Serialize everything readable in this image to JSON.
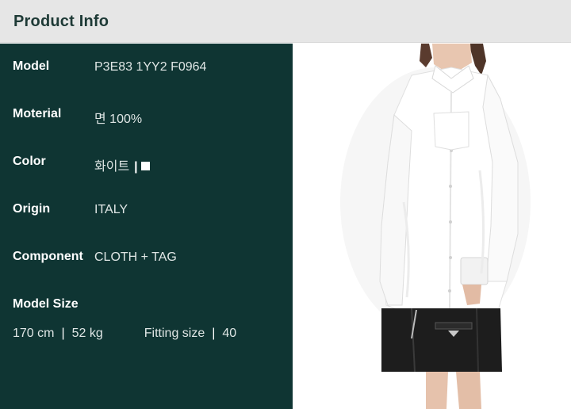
{
  "header": {
    "title": "Product Info"
  },
  "info": {
    "rows": [
      {
        "label": "Model",
        "value": "P3E83 1YY2 F0964"
      },
      {
        "label": "Moterial",
        "value": "면 100%"
      },
      {
        "label": "Color",
        "value": "화이트",
        "separator": "|"
      },
      {
        "label": "Origin",
        "value": "ITALY"
      },
      {
        "label": "Component",
        "value": "CLOTH + TAG"
      }
    ],
    "model_size": {
      "label": "Model Size",
      "height": "170 cm",
      "weight": "52 kg",
      "divider": "|",
      "fitting_label": "Fitting size",
      "fitting_value": "40"
    }
  },
  "colors": {
    "panel": "#0f3533",
    "header": "#e6e6e6",
    "header_text": "#1e3a36",
    "swatch": "#ffffff"
  }
}
